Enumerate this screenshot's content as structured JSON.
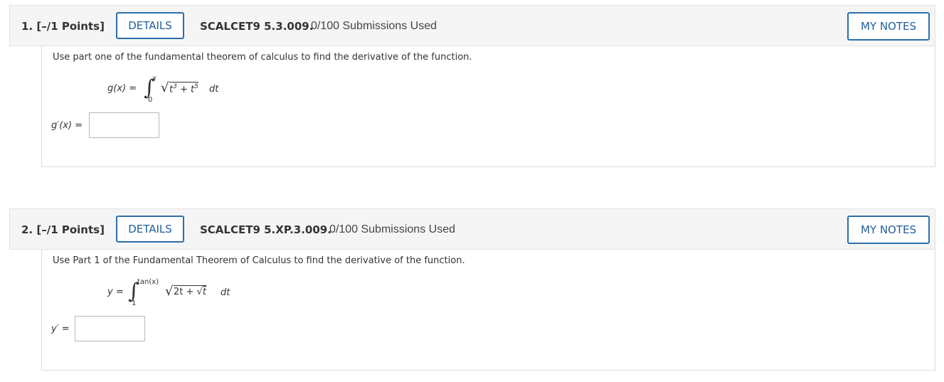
{
  "questions": [
    {
      "number": "1.",
      "points": "[–/1 Points]",
      "details_label": "DETAILS",
      "code": "SCALCET9 5.3.009.",
      "submissions": "0/100 Submissions Used",
      "notes_label": "MY NOTES",
      "prompt": "Use part one of the fundamental theorem of calculus to find the derivative of the function.",
      "function_lhs": "g(x) =",
      "upper_limit": "x",
      "lower_limit": "0",
      "radicand_a": "t",
      "radicand_a_exp": "3",
      "radicand_mid": " + t",
      "radicand_b_exp": "5",
      "dt": "dt",
      "answer_label": "g′(x) ="
    },
    {
      "number": "2.",
      "points": "[–/1 Points]",
      "details_label": "DETAILS",
      "code": "SCALCET9 5.XP.3.009.",
      "submissions": "0/100 Submissions Used",
      "notes_label": "MY NOTES",
      "prompt": "Use Part 1 of the Fundamental Theorem of Calculus to find the derivative of the function.",
      "function_lhs": "y =",
      "upper_limit": "tan(x)",
      "lower_limit": "1",
      "radicand_a": "2t + ",
      "inner_radicand": "t",
      "dt": "dt",
      "answer_label": "y′ ="
    }
  ]
}
